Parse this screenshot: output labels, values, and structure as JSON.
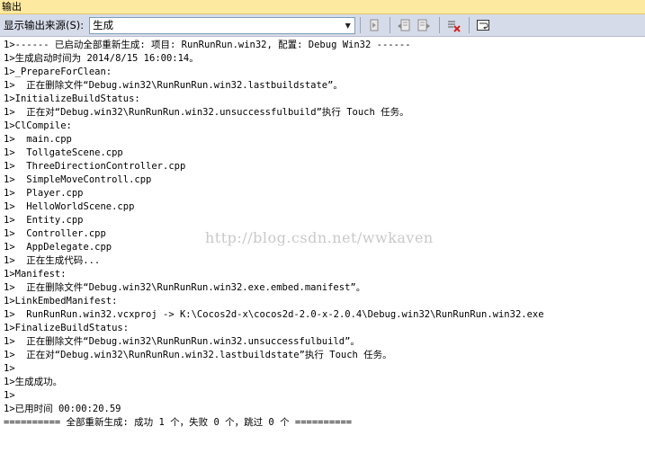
{
  "window": {
    "title": "输出"
  },
  "toolbar": {
    "source_label": "显示输出来源(S):",
    "source_value": "生成",
    "buttons": [
      {
        "name": "goto-line-icon"
      },
      {
        "name": "prev-message-icon"
      },
      {
        "name": "next-message-icon"
      },
      {
        "name": "clear-all-icon"
      },
      {
        "name": "word-wrap-icon"
      }
    ]
  },
  "output": {
    "lines": [
      "1>------ 已启动全部重新生成: 项目: RunRunRun.win32, 配置: Debug Win32 ------",
      "1>生成启动时间为 2014/8/15 16:00:14。",
      "1>_PrepareForClean:",
      "1>  正在删除文件“Debug.win32\\RunRunRun.win32.lastbuildstate”。",
      "1>InitializeBuildStatus:",
      "1>  正在对“Debug.win32\\RunRunRun.win32.unsuccessfulbuild”执行 Touch 任务。",
      "1>ClCompile:",
      "1>  main.cpp",
      "1>  TollgateScene.cpp",
      "1>  ThreeDirectionController.cpp",
      "1>  SimpleMoveControll.cpp",
      "1>  Player.cpp",
      "1>  HelloWorldScene.cpp",
      "1>  Entity.cpp",
      "1>  Controller.cpp",
      "1>  AppDelegate.cpp",
      "1>  正在生成代码...",
      "1>Manifest:",
      "1>  正在删除文件“Debug.win32\\RunRunRun.win32.exe.embed.manifest”。",
      "1>LinkEmbedManifest:",
      "1>  RunRunRun.win32.vcxproj -> K:\\Cocos2d-x\\cocos2d-2.0-x-2.0.4\\Debug.win32\\RunRunRun.win32.exe",
      "1>FinalizeBuildStatus:",
      "1>  正在删除文件“Debug.win32\\RunRunRun.win32.unsuccessfulbuild”。",
      "1>  正在对“Debug.win32\\RunRunRun.win32.lastbuildstate”执行 Touch 任务。",
      "1>",
      "1>生成成功。",
      "1>",
      "1>已用时间 00:00:20.59",
      "========== 全部重新生成: 成功 1 个，失败 0 个，跳过 0 个 =========="
    ],
    "watermark": "http://blog.csdn.net/wwkaven"
  }
}
